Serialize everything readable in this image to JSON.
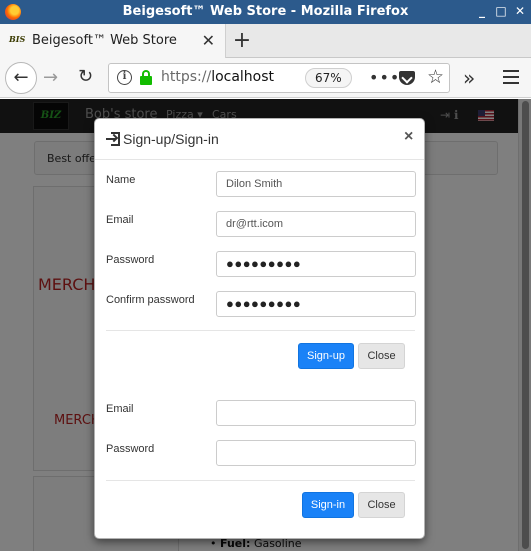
{
  "window": {
    "title": "Beigesoft™ Web Store - Mozilla Firefox",
    "controls": [
      "_",
      "□",
      "✕"
    ]
  },
  "tab": {
    "favicon_text": "BIS",
    "title": "Beigesoft™ Web Store",
    "close": "✕",
    "new_tab": "+"
  },
  "nav": {
    "back": "←",
    "forward": "→",
    "reload": "↻",
    "info": "i",
    "url_scheme": "https://",
    "url_host": "localhost",
    "zoom": "67%",
    "more": "•••",
    "star": "☆",
    "overflow": "»"
  },
  "page": {
    "logo_text": "BIZ",
    "store_name": "Bob's store",
    "menu": [
      "Pizza ▾",
      "Cars"
    ],
    "nav_icons": "⇥  ℹ",
    "offers": "Best offer",
    "merch_large": "MERCH",
    "merch_small": "MERCH",
    "fuel_label": "Fuel:",
    "fuel_value": "Gasoline"
  },
  "modal": {
    "title": "Sign-up/Sign-in",
    "close": "×",
    "signup": {
      "name_label": "Name",
      "name_value": "Dilon Smith",
      "email_label": "Email",
      "email_value": "dr@rtt.icom",
      "password_label": "Password",
      "password_value": "●●●●●●●●●",
      "confirm_label": "Confirm password",
      "confirm_value": "●●●●●●●●●",
      "submit": "Sign-up",
      "close": "Close"
    },
    "signin": {
      "email_label": "Email",
      "email_value": "",
      "password_label": "Password",
      "password_value": "",
      "submit": "Sign-in",
      "close": "Close"
    }
  },
  "colors": {
    "titlebar": "#2c5a8c",
    "primary_button": "#1a82f7",
    "lock_green": "#12bc00",
    "merch_red": "#bb2222"
  }
}
